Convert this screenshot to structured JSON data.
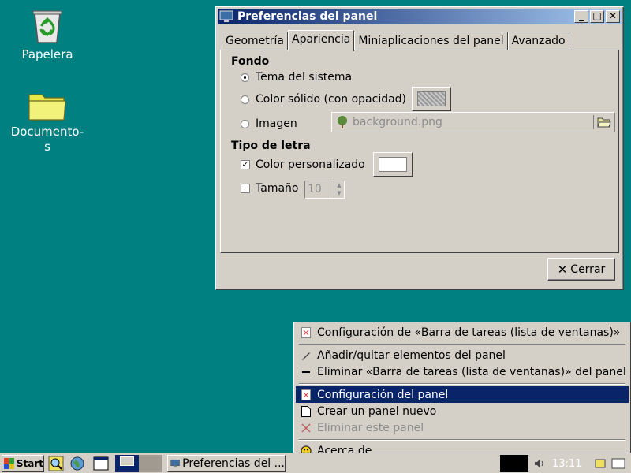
{
  "desktop": {
    "icons": [
      {
        "label": "Papelera"
      },
      {
        "label": "Documento-\ns"
      }
    ]
  },
  "window": {
    "title": "Preferencias del panel",
    "tabs": [
      {
        "label": "Geometría"
      },
      {
        "label": "Apariencia"
      },
      {
        "label": "Miniaplicaciones del panel"
      },
      {
        "label": "Avanzado"
      }
    ],
    "active_tab": "Apariencia",
    "fondo": {
      "heading": "Fondo",
      "options": [
        {
          "label": "Tema del sistema",
          "selected": true
        },
        {
          "label": "Color sólido (con opacidad)",
          "selected": false
        },
        {
          "label": "Imagen",
          "selected": false
        }
      ],
      "image_file": "background.png"
    },
    "tipo_letra": {
      "heading": "Tipo de letra",
      "custom_color_label": "Color personalizado",
      "custom_color_checked": true,
      "size_label": "Tamaño",
      "size_checked": false,
      "size_value": "10"
    },
    "close_button": {
      "prefix": "",
      "mnemonic": "C",
      "rest": "errar"
    }
  },
  "menu": {
    "items": [
      {
        "label": "Configuración de «Barra de tareas (lista de ventanas)»",
        "icon": "config-icon",
        "disabled": false,
        "highlight": false
      },
      {
        "label": "Añadir/quitar elementos del panel",
        "icon": "pencil-icon",
        "disabled": false,
        "highlight": false
      },
      {
        "label": "Eliminar «Barra de tareas (lista de ventanas)» del panel",
        "icon": "minus-icon",
        "disabled": false,
        "highlight": false
      },
      {
        "label": "Configuración del panel",
        "icon": "config-icon",
        "disabled": false,
        "highlight": true
      },
      {
        "label": "Crear un panel nuevo",
        "icon": "new-document-icon",
        "disabled": false,
        "highlight": false
      },
      {
        "label": "Eliminar este panel",
        "icon": "delete-icon",
        "disabled": true,
        "highlight": false
      },
      {
        "label": "Acerca de",
        "icon": "smiley-icon",
        "disabled": false,
        "highlight": false
      }
    ]
  },
  "taskbar": {
    "start_label": "Start",
    "task_label": "Preferencias del ...",
    "clock": "13:11"
  },
  "colors": {
    "desktop": "#008080",
    "highlight": "#0a246a",
    "face": "#d4d0c8"
  }
}
